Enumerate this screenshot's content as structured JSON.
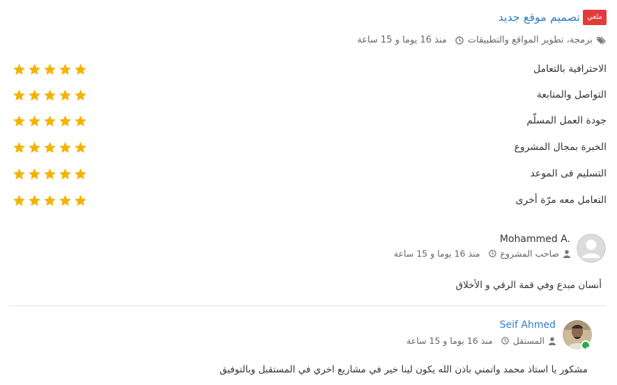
{
  "project": {
    "status_badge": "ملغي",
    "title": "تصميم موقع جديد",
    "category": "برمجة، تطوير المواقع والتطبيقات",
    "time_ago": "منذ 16 يوما و 15 ساعة"
  },
  "ratings": [
    {
      "label": "الاحترافية بالتعامل",
      "stars": 5
    },
    {
      "label": "التواصل والمتابعة",
      "stars": 5
    },
    {
      "label": "جودة العمل المسلّم",
      "stars": 5
    },
    {
      "label": "الخبرة بمجال المشروع",
      "stars": 5
    },
    {
      "label": "التسليم فى الموعد",
      "stars": 5
    },
    {
      "label": "التعامل معه مرّة أخرى",
      "stars": 5
    }
  ],
  "comments": [
    {
      "name": "Mohammed A.",
      "role": "صاحب المشروع",
      "time_ago": "منذ 16 يوما و 15 ساعة",
      "text": "أنسان مبدع وفي قمة الرقي و الأخلاق"
    },
    {
      "name": "Seif Ahmed",
      "role": "المستقل",
      "time_ago": "منذ 16 يوما و 15 ساعة",
      "text": "مشكور يا استاذ محمد واتمني باذن الله يكون لينا خير في مشاريع اخري في المستقبل وبالتوفيق"
    }
  ],
  "colors": {
    "star": "#f5b301",
    "link": "#2f7fc4",
    "badge": "#e23b3b",
    "online": "#2fa84f"
  }
}
